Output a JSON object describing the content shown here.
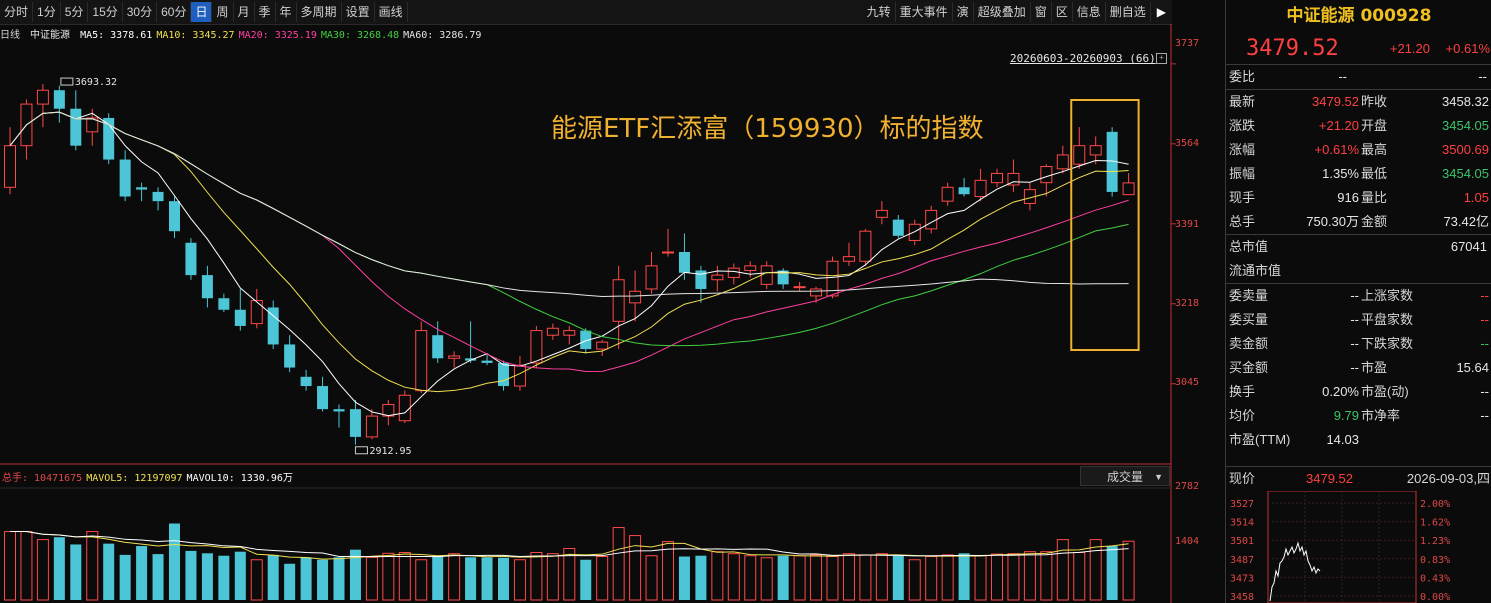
{
  "toolbar": {
    "periods": [
      {
        "label": "分时",
        "active": false
      },
      {
        "label": "1分",
        "active": false
      },
      {
        "label": "5分",
        "active": false
      },
      {
        "label": "15分",
        "active": false
      },
      {
        "label": "30分",
        "active": false
      },
      {
        "label": "60分",
        "active": false
      },
      {
        "label": "日",
        "active": true
      },
      {
        "label": "周",
        "active": false
      },
      {
        "label": "月",
        "active": false
      },
      {
        "label": "季",
        "active": false
      },
      {
        "label": "年",
        "active": false
      },
      {
        "label": "多周期",
        "active": false
      },
      {
        "label": "设置",
        "active": false
      },
      {
        "label": "画线",
        "active": false
      }
    ],
    "right_tools": [
      "九转",
      "重大事件",
      "演",
      "超级叠加",
      "窗",
      "区",
      "信息",
      "删自选"
    ],
    "collapse_icon": "collapse-right-icon"
  },
  "chart": {
    "period_label": "日线",
    "name": "中证能源",
    "ma": [
      {
        "label": "MA5:",
        "value": "3378.61",
        "color": "#ffffff"
      },
      {
        "label": "MA10:",
        "value": "3345.27",
        "color": "#f0e050"
      },
      {
        "label": "MA20:",
        "value": "3325.19",
        "color": "#ff40a0"
      },
      {
        "label": "MA30:",
        "value": "3268.48",
        "color": "#40d040"
      },
      {
        "label": "MA60:",
        "value": "3286.79",
        "color": "#e6e6e6"
      }
    ],
    "range_label": "20260603-20260903 (66)",
    "annotation": "能源ETF汇添富（159930）标的指数",
    "high_marker": "3693.32",
    "low_marker": "2912.95",
    "y_labels": [
      "3737",
      "3564",
      "3391",
      "3218",
      "3045"
    ]
  },
  "volume": {
    "header": [
      {
        "label": "总手:",
        "value": "10471675",
        "color": "#e04848"
      },
      {
        "label": "MAVOL5:",
        "value": "12197097",
        "color": "#f0e050"
      },
      {
        "label": "MAVOL10:",
        "value": "1330.96万",
        "color": "#ffffff"
      }
    ],
    "indicator": "成交量",
    "y_labels": [
      "2782",
      "1404"
    ]
  },
  "panel": {
    "title": "中证能源 000928",
    "price": "3479.52",
    "change": "+21.20",
    "change_pct": "+0.61%",
    "weibi": {
      "label": "委比",
      "v1": "--",
      "v2": "--"
    },
    "rows": [
      {
        "k": "最新",
        "v": "3479.52",
        "vc": "red",
        "k2": "昨收",
        "v2": "3458.32",
        "v2c": "white"
      },
      {
        "k": "涨跌",
        "v": "+21.20",
        "vc": "red",
        "k2": "开盘",
        "v2": "3454.05",
        "v2c": "green"
      },
      {
        "k": "涨幅",
        "v": "+0.61%",
        "vc": "red",
        "k2": "最高",
        "v2": "3500.69",
        "v2c": "red"
      },
      {
        "k": "振幅",
        "v": "1.35%",
        "vc": "white",
        "k2": "最低",
        "v2": "3454.05",
        "v2c": "green"
      },
      {
        "k": "现手",
        "v": "916",
        "vc": "white",
        "k2": "量比",
        "v2": "1.05",
        "v2c": "red"
      },
      {
        "k": "总手",
        "v": "750.30万",
        "vc": "white",
        "k2": "金额",
        "v2": "73.42亿",
        "v2c": "white"
      }
    ],
    "total_cap": {
      "k": "总市值",
      "v": "67041"
    },
    "float_cap": {
      "k": "流通市值",
      "v": ""
    },
    "rows2": [
      {
        "k": "委卖量",
        "v": "--",
        "vc": "white",
        "k2": "上涨家数",
        "v2": "--",
        "v2c": "red"
      },
      {
        "k": "委买量",
        "v": "--",
        "vc": "white",
        "k2": "平盘家数",
        "v2": "--",
        "v2c": "red"
      },
      {
        "k": "卖金额",
        "v": "--",
        "vc": "white",
        "k2": "下跌家数",
        "v2": "--",
        "v2c": "green"
      },
      {
        "k": "买金额",
        "v": "--",
        "vc": "white",
        "k2": "市盈",
        "v2": "15.64",
        "v2c": "white"
      },
      {
        "k": "换手",
        "v": "0.20%",
        "vc": "white",
        "k2": "市盈(动)",
        "v2": "--",
        "v2c": "white"
      },
      {
        "k": "均价",
        "v": "9.79",
        "vc": "green",
        "k2": "市净率",
        "v2": "--",
        "v2c": "white"
      },
      {
        "k": "市盈(TTM)",
        "v": "14.03",
        "vc": "white",
        "k2": "",
        "v2": "",
        "v2c": "white"
      }
    ],
    "mini": {
      "label": "现价",
      "price": "3479.52",
      "date": "2026-09-03,四",
      "left_labels": [
        "3527",
        "3514",
        "3501",
        "3487",
        "3473",
        "3458"
      ],
      "right_labels": [
        "2.00%",
        "1.62%",
        "1.23%",
        "0.83%",
        "0.43%",
        "0.00%"
      ]
    }
  },
  "chart_data": {
    "type": "candlestick",
    "title": "中证能源",
    "period": "20260603-20260903",
    "count": 66,
    "ylim": [
      2880,
      3780
    ],
    "candles": [
      {
        "o": 3470,
        "h": 3600,
        "l": 3455,
        "c": 3560
      },
      {
        "o": 3560,
        "h": 3660,
        "l": 3530,
        "c": 3650
      },
      {
        "o": 3650,
        "h": 3693.32,
        "l": 3600,
        "c": 3680
      },
      {
        "o": 3680,
        "h": 3690,
        "l": 3610,
        "c": 3640
      },
      {
        "o": 3640,
        "h": 3680,
        "l": 3550,
        "c": 3560
      },
      {
        "o": 3590,
        "h": 3640,
        "l": 3560,
        "c": 3620
      },
      {
        "o": 3620,
        "h": 3630,
        "l": 3520,
        "c": 3530
      },
      {
        "o": 3530,
        "h": 3550,
        "l": 3440,
        "c": 3450
      },
      {
        "o": 3470,
        "h": 3480,
        "l": 3440,
        "c": 3465
      },
      {
        "o": 3460,
        "h": 3470,
        "l": 3420,
        "c": 3440
      },
      {
        "o": 3440,
        "h": 3450,
        "l": 3360,
        "c": 3375
      },
      {
        "o": 3350,
        "h": 3360,
        "l": 3270,
        "c": 3280
      },
      {
        "o": 3280,
        "h": 3300,
        "l": 3210,
        "c": 3230
      },
      {
        "o": 3230,
        "h": 3240,
        "l": 3200,
        "c": 3205
      },
      {
        "o": 3205,
        "h": 3250,
        "l": 3160,
        "c": 3170
      },
      {
        "o": 3175,
        "h": 3250,
        "l": 3165,
        "c": 3225
      },
      {
        "o": 3210,
        "h": 3225,
        "l": 3120,
        "c": 3130
      },
      {
        "o": 3130,
        "h": 3150,
        "l": 3070,
        "c": 3080
      },
      {
        "o": 3060,
        "h": 3075,
        "l": 3030,
        "c": 3040
      },
      {
        "o": 3040,
        "h": 3060,
        "l": 2985,
        "c": 2990
      },
      {
        "o": 2990,
        "h": 3000,
        "l": 2950,
        "c": 2985
      },
      {
        "o": 2990,
        "h": 3010,
        "l": 2912.95,
        "c": 2930
      },
      {
        "o": 2930,
        "h": 2990,
        "l": 2925,
        "c": 2975
      },
      {
        "o": 2975,
        "h": 3010,
        "l": 2955,
        "c": 3000
      },
      {
        "o": 2965,
        "h": 3030,
        "l": 2960,
        "c": 3020
      },
      {
        "o": 3030,
        "h": 3180,
        "l": 3025,
        "c": 3160
      },
      {
        "o": 3150,
        "h": 3180,
        "l": 3090,
        "c": 3100
      },
      {
        "o": 3100,
        "h": 3115,
        "l": 3080,
        "c": 3105
      },
      {
        "o": 3100,
        "h": 3180,
        "l": 3090,
        "c": 3095
      },
      {
        "o": 3095,
        "h": 3110,
        "l": 3085,
        "c": 3090
      },
      {
        "o": 3090,
        "h": 3095,
        "l": 3030,
        "c": 3040
      },
      {
        "o": 3040,
        "h": 3105,
        "l": 3030,
        "c": 3085
      },
      {
        "o": 3090,
        "h": 3170,
        "l": 3080,
        "c": 3160
      },
      {
        "o": 3150,
        "h": 3175,
        "l": 3140,
        "c": 3165
      },
      {
        "o": 3150,
        "h": 3170,
        "l": 3130,
        "c": 3160
      },
      {
        "o": 3160,
        "h": 3165,
        "l": 3110,
        "c": 3120
      },
      {
        "o": 3120,
        "h": 3140,
        "l": 3105,
        "c": 3135
      },
      {
        "o": 3180,
        "h": 3300,
        "l": 3120,
        "c": 3270
      },
      {
        "o": 3220,
        "h": 3290,
        "l": 3180,
        "c": 3245
      },
      {
        "o": 3250,
        "h": 3330,
        "l": 3240,
        "c": 3300
      },
      {
        "o": 3330,
        "h": 3380,
        "l": 3320,
        "c": 3330
      },
      {
        "o": 3330,
        "h": 3370,
        "l": 3270,
        "c": 3285
      },
      {
        "o": 3290,
        "h": 3300,
        "l": 3220,
        "c": 3250
      },
      {
        "o": 3270,
        "h": 3300,
        "l": 3245,
        "c": 3280
      },
      {
        "o": 3275,
        "h": 3305,
        "l": 3260,
        "c": 3295
      },
      {
        "o": 3290,
        "h": 3310,
        "l": 3275,
        "c": 3300
      },
      {
        "o": 3260,
        "h": 3310,
        "l": 3250,
        "c": 3300
      },
      {
        "o": 3290,
        "h": 3295,
        "l": 3250,
        "c": 3260
      },
      {
        "o": 3255,
        "h": 3265,
        "l": 3245,
        "c": 3255
      },
      {
        "o": 3235,
        "h": 3255,
        "l": 3220,
        "c": 3250
      },
      {
        "o": 3235,
        "h": 3320,
        "l": 3230,
        "c": 3310
      },
      {
        "o": 3310,
        "h": 3350,
        "l": 3300,
        "c": 3320
      },
      {
        "o": 3310,
        "h": 3380,
        "l": 3300,
        "c": 3375
      },
      {
        "o": 3405,
        "h": 3440,
        "l": 3390,
        "c": 3420
      },
      {
        "o": 3400,
        "h": 3410,
        "l": 3360,
        "c": 3365
      },
      {
        "o": 3355,
        "h": 3400,
        "l": 3345,
        "c": 3390
      },
      {
        "o": 3380,
        "h": 3430,
        "l": 3370,
        "c": 3420
      },
      {
        "o": 3440,
        "h": 3480,
        "l": 3430,
        "c": 3470
      },
      {
        "o": 3470,
        "h": 3490,
        "l": 3450,
        "c": 3455
      },
      {
        "o": 3450,
        "h": 3510,
        "l": 3440,
        "c": 3485
      },
      {
        "o": 3480,
        "h": 3510,
        "l": 3470,
        "c": 3500
      },
      {
        "o": 3475,
        "h": 3530,
        "l": 3460,
        "c": 3500
      },
      {
        "o": 3435,
        "h": 3480,
        "l": 3420,
        "c": 3465
      },
      {
        "o": 3480,
        "h": 3520,
        "l": 3450,
        "c": 3515
      },
      {
        "o": 3510,
        "h": 3560,
        "l": 3500,
        "c": 3540
      },
      {
        "o": 3520,
        "h": 3600,
        "l": 3510,
        "c": 3560
      },
      {
        "o": 3540,
        "h": 3580,
        "l": 3520,
        "c": 3560
      },
      {
        "o": 3590,
        "h": 3600,
        "l": 3450,
        "c": 3460
      },
      {
        "o": 3454.05,
        "h": 3500.69,
        "l": 3454.05,
        "c": 3479.52
      }
    ],
    "volumes": [
      1700,
      1700,
      1500,
      1560,
      1380,
      1700,
      1400,
      1120,
      1340,
      1140,
      1900,
      1220,
      1160,
      1100,
      1200,
      1000,
      1120,
      900,
      1060,
      1000,
      1060,
      1250,
      1060,
      1160,
      1180,
      1000,
      1100,
      1150,
      1060,
      1060,
      1050,
      1000,
      1180,
      1150,
      1280,
      1000,
      1080,
      1800,
      1600,
      1100,
      1450,
      1080,
      1100,
      1200,
      1150,
      1100,
      1050,
      1100,
      1100,
      1120,
      1080,
      1150,
      1120,
      1150,
      1100,
      1000,
      1080,
      1120,
      1160,
      1100,
      1140,
      1150,
      1200,
      1200,
      1500,
      1180,
      1500,
      1340,
      1460,
      1500,
      520
    ],
    "vol_ylim": [
      0,
      2782
    ],
    "ma_latest": {
      "MA5": 3378.61,
      "MA10": 3345.27,
      "MA20": 3325.19,
      "MA30": 3268.48,
      "MA60": 3286.79
    }
  }
}
